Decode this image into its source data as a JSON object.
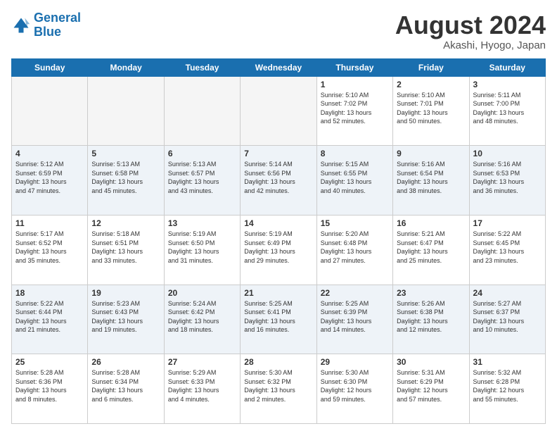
{
  "logo": {
    "line1": "General",
    "line2": "Blue"
  },
  "title": {
    "month": "August 2024",
    "location": "Akashi, Hyogo, Japan"
  },
  "weekdays": [
    "Sunday",
    "Monday",
    "Tuesday",
    "Wednesday",
    "Thursday",
    "Friday",
    "Saturday"
  ],
  "weeks": [
    [
      {
        "day": "",
        "info": ""
      },
      {
        "day": "",
        "info": ""
      },
      {
        "day": "",
        "info": ""
      },
      {
        "day": "",
        "info": ""
      },
      {
        "day": "1",
        "info": "Sunrise: 5:10 AM\nSunset: 7:02 PM\nDaylight: 13 hours\nand 52 minutes."
      },
      {
        "day": "2",
        "info": "Sunrise: 5:10 AM\nSunset: 7:01 PM\nDaylight: 13 hours\nand 50 minutes."
      },
      {
        "day": "3",
        "info": "Sunrise: 5:11 AM\nSunset: 7:00 PM\nDaylight: 13 hours\nand 48 minutes."
      }
    ],
    [
      {
        "day": "4",
        "info": "Sunrise: 5:12 AM\nSunset: 6:59 PM\nDaylight: 13 hours\nand 47 minutes."
      },
      {
        "day": "5",
        "info": "Sunrise: 5:13 AM\nSunset: 6:58 PM\nDaylight: 13 hours\nand 45 minutes."
      },
      {
        "day": "6",
        "info": "Sunrise: 5:13 AM\nSunset: 6:57 PM\nDaylight: 13 hours\nand 43 minutes."
      },
      {
        "day": "7",
        "info": "Sunrise: 5:14 AM\nSunset: 6:56 PM\nDaylight: 13 hours\nand 42 minutes."
      },
      {
        "day": "8",
        "info": "Sunrise: 5:15 AM\nSunset: 6:55 PM\nDaylight: 13 hours\nand 40 minutes."
      },
      {
        "day": "9",
        "info": "Sunrise: 5:16 AM\nSunset: 6:54 PM\nDaylight: 13 hours\nand 38 minutes."
      },
      {
        "day": "10",
        "info": "Sunrise: 5:16 AM\nSunset: 6:53 PM\nDaylight: 13 hours\nand 36 minutes."
      }
    ],
    [
      {
        "day": "11",
        "info": "Sunrise: 5:17 AM\nSunset: 6:52 PM\nDaylight: 13 hours\nand 35 minutes."
      },
      {
        "day": "12",
        "info": "Sunrise: 5:18 AM\nSunset: 6:51 PM\nDaylight: 13 hours\nand 33 minutes."
      },
      {
        "day": "13",
        "info": "Sunrise: 5:19 AM\nSunset: 6:50 PM\nDaylight: 13 hours\nand 31 minutes."
      },
      {
        "day": "14",
        "info": "Sunrise: 5:19 AM\nSunset: 6:49 PM\nDaylight: 13 hours\nand 29 minutes."
      },
      {
        "day": "15",
        "info": "Sunrise: 5:20 AM\nSunset: 6:48 PM\nDaylight: 13 hours\nand 27 minutes."
      },
      {
        "day": "16",
        "info": "Sunrise: 5:21 AM\nSunset: 6:47 PM\nDaylight: 13 hours\nand 25 minutes."
      },
      {
        "day": "17",
        "info": "Sunrise: 5:22 AM\nSunset: 6:45 PM\nDaylight: 13 hours\nand 23 minutes."
      }
    ],
    [
      {
        "day": "18",
        "info": "Sunrise: 5:22 AM\nSunset: 6:44 PM\nDaylight: 13 hours\nand 21 minutes."
      },
      {
        "day": "19",
        "info": "Sunrise: 5:23 AM\nSunset: 6:43 PM\nDaylight: 13 hours\nand 19 minutes."
      },
      {
        "day": "20",
        "info": "Sunrise: 5:24 AM\nSunset: 6:42 PM\nDaylight: 13 hours\nand 18 minutes."
      },
      {
        "day": "21",
        "info": "Sunrise: 5:25 AM\nSunset: 6:41 PM\nDaylight: 13 hours\nand 16 minutes."
      },
      {
        "day": "22",
        "info": "Sunrise: 5:25 AM\nSunset: 6:39 PM\nDaylight: 13 hours\nand 14 minutes."
      },
      {
        "day": "23",
        "info": "Sunrise: 5:26 AM\nSunset: 6:38 PM\nDaylight: 13 hours\nand 12 minutes."
      },
      {
        "day": "24",
        "info": "Sunrise: 5:27 AM\nSunset: 6:37 PM\nDaylight: 13 hours\nand 10 minutes."
      }
    ],
    [
      {
        "day": "25",
        "info": "Sunrise: 5:28 AM\nSunset: 6:36 PM\nDaylight: 13 hours\nand 8 minutes."
      },
      {
        "day": "26",
        "info": "Sunrise: 5:28 AM\nSunset: 6:34 PM\nDaylight: 13 hours\nand 6 minutes."
      },
      {
        "day": "27",
        "info": "Sunrise: 5:29 AM\nSunset: 6:33 PM\nDaylight: 13 hours\nand 4 minutes."
      },
      {
        "day": "28",
        "info": "Sunrise: 5:30 AM\nSunset: 6:32 PM\nDaylight: 13 hours\nand 2 minutes."
      },
      {
        "day": "29",
        "info": "Sunrise: 5:30 AM\nSunset: 6:30 PM\nDaylight: 12 hours\nand 59 minutes."
      },
      {
        "day": "30",
        "info": "Sunrise: 5:31 AM\nSunset: 6:29 PM\nDaylight: 12 hours\nand 57 minutes."
      },
      {
        "day": "31",
        "info": "Sunrise: 5:32 AM\nSunset: 6:28 PM\nDaylight: 12 hours\nand 55 minutes."
      }
    ]
  ]
}
